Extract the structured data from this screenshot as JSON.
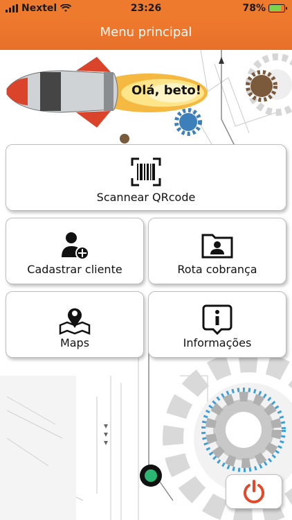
{
  "status_bar": {
    "carrier": "Nextel",
    "time": "23:26",
    "battery": "78%",
    "battery_level": 0.78
  },
  "nav": {
    "title": "Menu principal"
  },
  "greeting": "Olá, beto!",
  "buttons": {
    "scan": "Scannear QRcode",
    "cadastrar": "Cadastrar cliente",
    "rota": "Rota cobrança",
    "maps": "Maps",
    "info": "Informações"
  },
  "icons": {
    "scan": "barcode-scan-icon",
    "cadastrar": "add-user-icon",
    "rota": "contact-folder-icon",
    "maps": "map-pin-icon",
    "info": "info-bubble-icon",
    "power": "power-icon"
  },
  "colors": {
    "header": "#ee7a2e",
    "power": "#e04a2a",
    "battery": "#7bd54b"
  }
}
